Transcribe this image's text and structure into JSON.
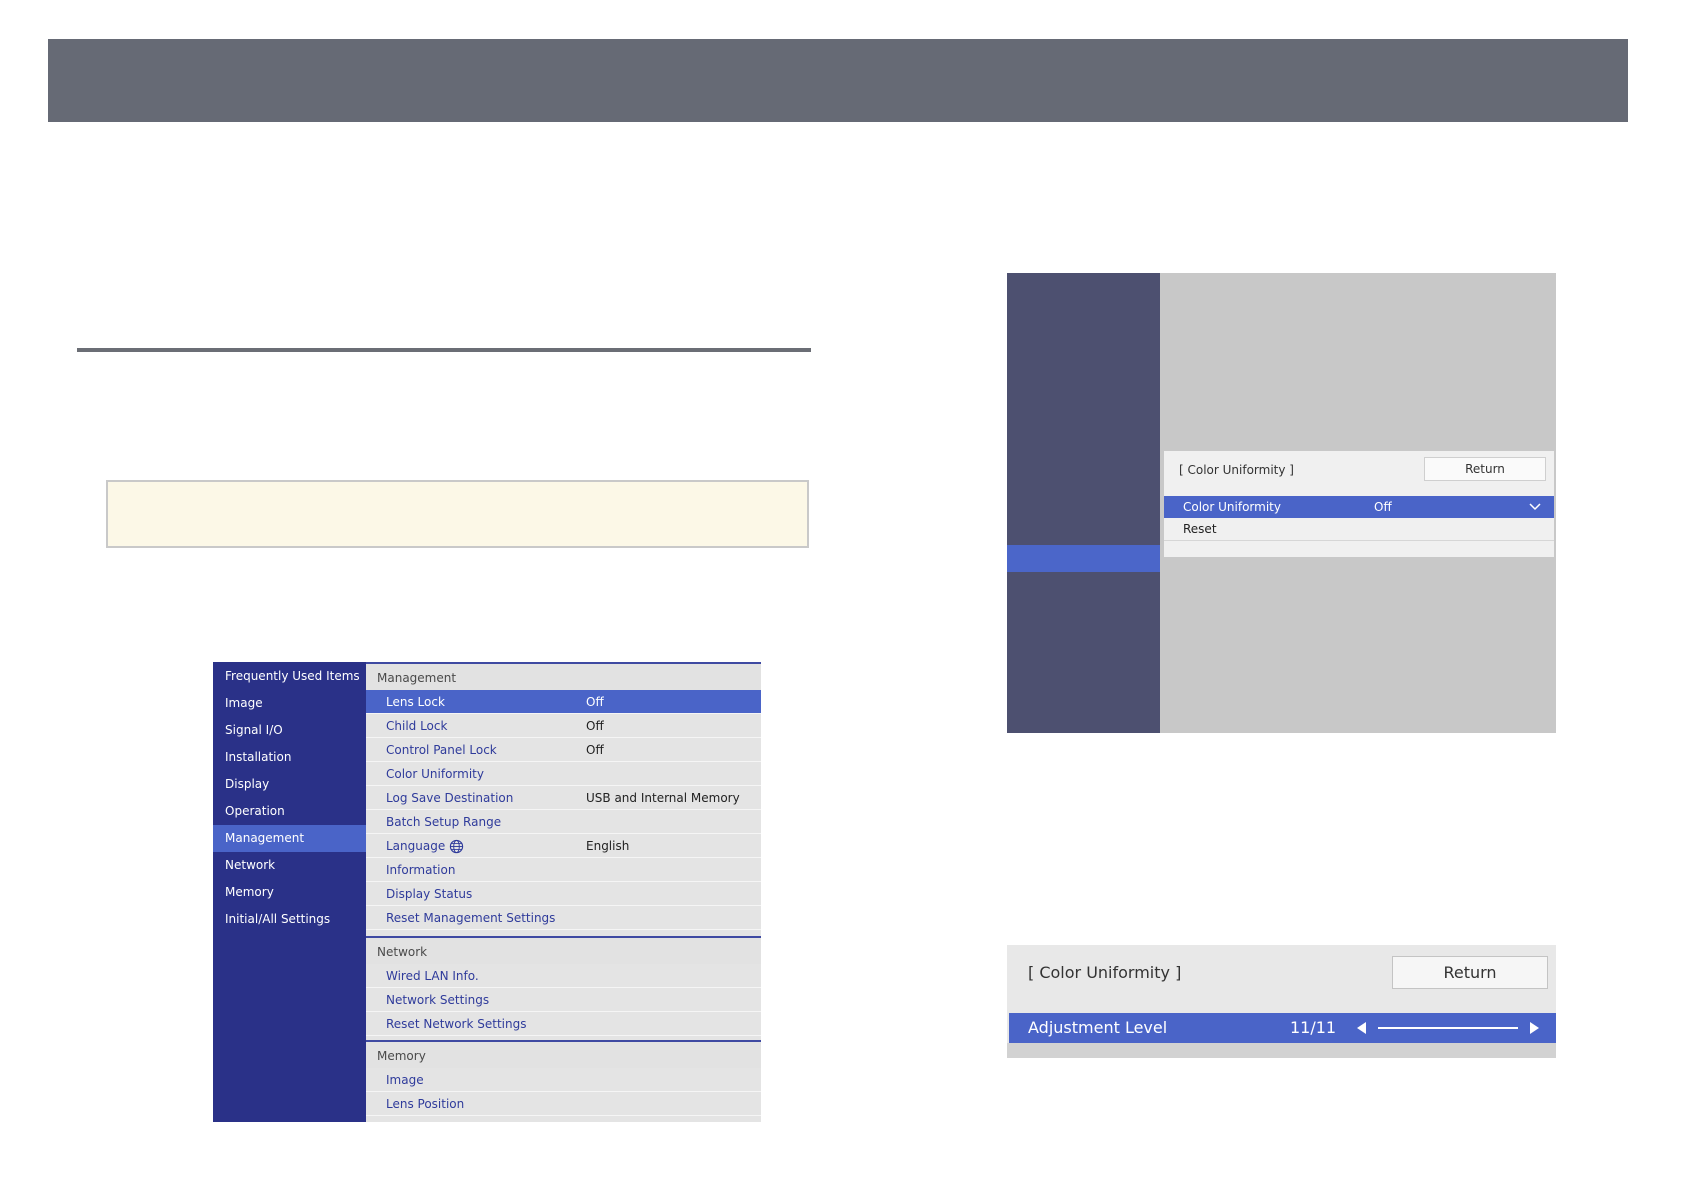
{
  "menu1": {
    "sidebar": [
      "Frequently Used Items",
      "Image",
      "Signal I/O",
      "Installation",
      "Display",
      "Operation",
      "Management",
      "Network",
      "Memory",
      "Initial/All Settings"
    ],
    "selected_sidebar": "Management",
    "sections": {
      "management": {
        "title": "Management",
        "rows": [
          {
            "label": "Lens Lock",
            "value": "Off"
          },
          {
            "label": "Child Lock",
            "value": "Off"
          },
          {
            "label": "Control Panel Lock",
            "value": "Off"
          },
          {
            "label": "Color Uniformity",
            "value": ""
          },
          {
            "label": "Log Save Destination",
            "value": "USB and Internal Memory"
          },
          {
            "label": "Batch Setup Range",
            "value": ""
          },
          {
            "label": "Language",
            "value": "English"
          },
          {
            "label": "Information",
            "value": ""
          },
          {
            "label": "Display Status",
            "value": ""
          },
          {
            "label": "Reset Management Settings",
            "value": ""
          }
        ]
      },
      "network": {
        "title": "Network",
        "rows": [
          {
            "label": "Wired LAN Info.",
            "value": ""
          },
          {
            "label": "Network Settings",
            "value": ""
          },
          {
            "label": "Reset Network Settings",
            "value": ""
          }
        ]
      },
      "memory": {
        "title": "Memory",
        "rows": [
          {
            "label": "Image",
            "value": ""
          },
          {
            "label": "Lens Position",
            "value": ""
          }
        ]
      }
    }
  },
  "menu2": {
    "dialog_title": "[ Color Uniformity ]",
    "return_label": "Return",
    "rows": [
      {
        "label": "Color Uniformity",
        "value": "Off"
      },
      {
        "label": "Reset",
        "value": ""
      }
    ]
  },
  "menu3": {
    "title": "[ Color Uniformity ]",
    "return_label": "Return",
    "adjustment_label": "Adjustment Level",
    "adjustment_value": "11/11",
    "adjustment_level": 1.0
  },
  "colors": {
    "header_bar": "#666a75",
    "menu_sidebar": "#2a3188",
    "highlight": "#4a64c8",
    "note_box": "#fcf8e7"
  }
}
